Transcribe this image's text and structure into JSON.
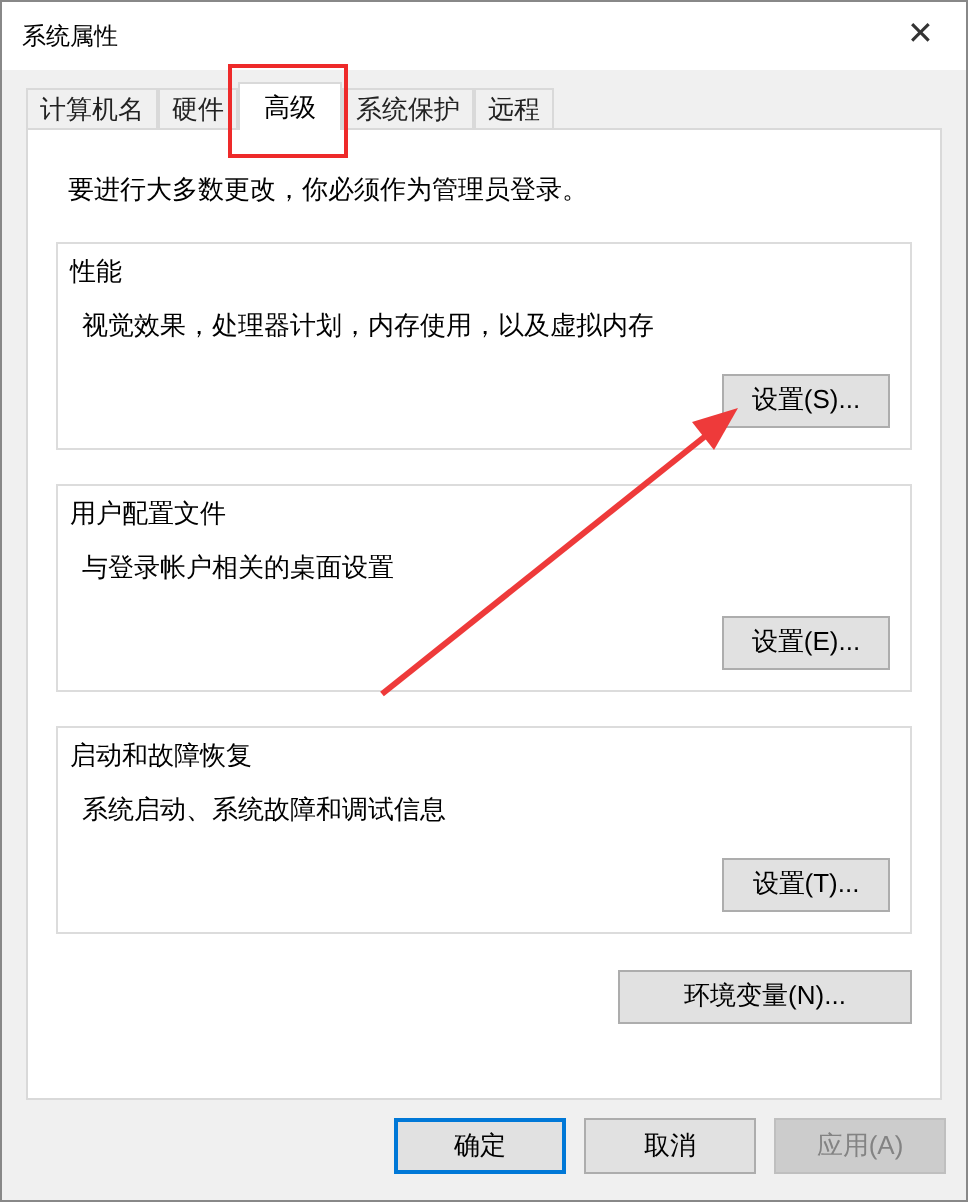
{
  "window": {
    "title": "系统属性",
    "close": "✕"
  },
  "tabs": [
    {
      "label": "计算机名",
      "selected": false
    },
    {
      "label": "硬件",
      "selected": false
    },
    {
      "label": "高级",
      "selected": true
    },
    {
      "label": "系统保护",
      "selected": false
    },
    {
      "label": "远程",
      "selected": false
    }
  ],
  "notice": "要进行大多数更改，你必须作为管理员登录。",
  "groups": [
    {
      "title": "性能",
      "description": "视觉效果，处理器计划，内存使用，以及虚拟内存",
      "button": "设置(S)..."
    },
    {
      "title": "用户配置文件",
      "description": "与登录帐户相关的桌面设置",
      "button": "设置(E)..."
    },
    {
      "title": "启动和故障恢复",
      "description": "系统启动、系统故障和调试信息",
      "button": "设置(T)..."
    }
  ],
  "env_button": "环境变量(N)...",
  "buttons": [
    {
      "label": "确定",
      "default": true,
      "disabled": false
    },
    {
      "label": "取消",
      "default": false,
      "disabled": false
    },
    {
      "label": "应用(A)",
      "default": false,
      "disabled": true
    }
  ]
}
